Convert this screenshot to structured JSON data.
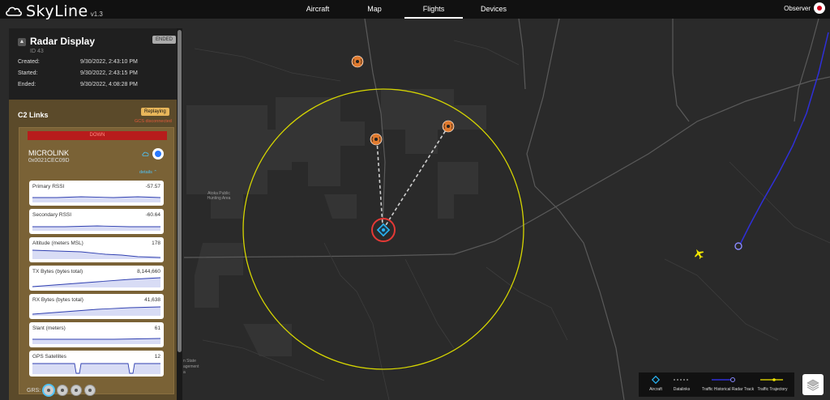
{
  "app": {
    "name": "SkyLine",
    "version": "v1.3"
  },
  "nav": {
    "tabs": [
      {
        "label": "Aircraft",
        "active": false
      },
      {
        "label": "Map",
        "active": false
      },
      {
        "label": "Flights",
        "active": true
      },
      {
        "label": "Devices",
        "active": false
      }
    ]
  },
  "user": {
    "name": "Observer"
  },
  "flight": {
    "title": "Radar Display",
    "id": "ID 43",
    "status": "ENDED",
    "rows": [
      {
        "label": "Created:",
        "value": "9/30/2022, 2:43:10 PM"
      },
      {
        "label": "Started:",
        "value": "9/30/2022, 2:43:15 PM"
      },
      {
        "label": "Ended:",
        "value": "9/30/2022, 4:08:28 PM"
      }
    ]
  },
  "c2": {
    "title": "C2 Links",
    "replaying": "Replaying",
    "disconnected": "GCS disconnected",
    "link": {
      "status": "DOWN",
      "name": "MICROLINK",
      "address": "0x0021CEC09D",
      "details": "details"
    },
    "metrics": [
      {
        "label": "Primary RSSI",
        "value": "-57.57"
      },
      {
        "label": "Secondary RSSI",
        "value": "-60.64"
      },
      {
        "label": "Altitude (meters MSL)",
        "value": "178"
      },
      {
        "label": "TX Bytes (bytes total)",
        "value": "8,144,660"
      },
      {
        "label": "RX Bytes (bytes total)",
        "value": "41,638"
      },
      {
        "label": "Slant (meters)",
        "value": "61"
      },
      {
        "label": "GPS Satellites",
        "value": "12"
      }
    ],
    "grs_label": "GRS:"
  },
  "map": {
    "labels": [
      {
        "text": "Atoka Public Hunting Area"
      },
      {
        "text": "n State"
      },
      {
        "text": "agement"
      },
      {
        "text": "a"
      }
    ]
  },
  "legend": {
    "items": [
      {
        "label": "Aircraft",
        "icon": "diamond-icon"
      },
      {
        "label": "Datalinks",
        "icon": "dashed-line-icon"
      },
      {
        "label": "Traffic Historical Radar Track",
        "icon": "radar-track-icon"
      },
      {
        "label": "Traffic Trajectory",
        "icon": "trajectory-icon"
      }
    ]
  },
  "colors": {
    "range_ring": "#d6d600",
    "radar_track": "#2f2fd8",
    "device": "#e07a2e",
    "aircraft": "#29b6f6",
    "alert": "#e53935",
    "c2_panel": "#5b4a2a"
  }
}
